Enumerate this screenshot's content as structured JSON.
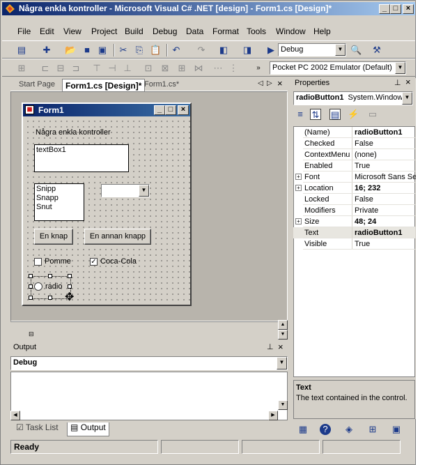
{
  "window": {
    "title": "Några enkla kontroller - Microsoft Visual C# .NET [design] - Form1.cs [Design]*",
    "min": "_",
    "max": "□",
    "close": "×"
  },
  "menu": [
    "File",
    "Edit",
    "View",
    "Project",
    "Build",
    "Debug",
    "Data",
    "Format",
    "Tools",
    "Window",
    "Help"
  ],
  "toolbar": {
    "config": "Debug",
    "device": "Pocket PC 2002 Emulator (Default)"
  },
  "tabs": [
    "Start Page",
    "Form1.cs [Design]*",
    "Form1.cs*"
  ],
  "form": {
    "title": "Form1",
    "label": "Några enkla kontroller",
    "textbox": "textBox1",
    "list": [
      "Snipp",
      "Snapp",
      "Snut"
    ],
    "button1": "En knap",
    "button2": "En annan knapp",
    "check1": "Pomme",
    "check2": "Coca-Cola",
    "radio": "radio"
  },
  "properties": {
    "title": "Properties",
    "object": "radioButton1",
    "type": "System.Windows",
    "rows": [
      {
        "name": "(Name)",
        "value": "radioButton1",
        "bold": true,
        "expand": false
      },
      {
        "name": "Checked",
        "value": "False",
        "bold": false,
        "expand": false
      },
      {
        "name": "ContextMenu",
        "value": "(none)",
        "bold": false,
        "expand": false
      },
      {
        "name": "Enabled",
        "value": "True",
        "bold": false,
        "expand": false
      },
      {
        "name": "Font",
        "value": "Microsoft Sans Serif",
        "bold": false,
        "expand": true
      },
      {
        "name": "Location",
        "value": "16; 232",
        "bold": true,
        "expand": true
      },
      {
        "name": "Locked",
        "value": "False",
        "bold": false,
        "expand": false
      },
      {
        "name": "Modifiers",
        "value": "Private",
        "bold": false,
        "expand": false
      },
      {
        "name": "Size",
        "value": "48; 24",
        "bold": true,
        "expand": true
      },
      {
        "name": "Text",
        "value": "radioButton1",
        "bold": true,
        "expand": false
      },
      {
        "name": "Visible",
        "value": "True",
        "bold": false,
        "expand": false
      }
    ],
    "desc_title": "Text",
    "desc_text": "The text contained in the control."
  },
  "output": {
    "title": "Output",
    "combo": "Debug"
  },
  "bottom_tabs": [
    "Task List",
    "Output"
  ],
  "status": "Ready"
}
